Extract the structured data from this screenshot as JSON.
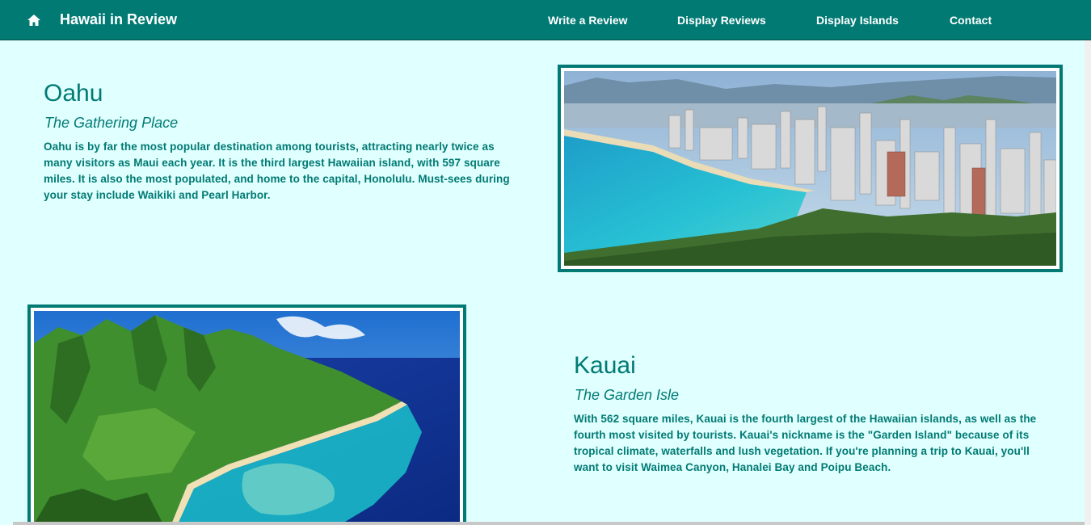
{
  "navbar": {
    "brand": "Hawaii in Review",
    "home_icon": "home-icon",
    "links": [
      "Write a Review",
      "Display Reviews",
      "Display Islands",
      "Contact"
    ]
  },
  "islands": [
    {
      "name": "Oahu",
      "nickname": "The Gathering Place",
      "description": "Oahu is by far the most popular destination among tourists, attracting nearly twice as many visitors as Maui each year. It is the third largest Hawaiian island, with 597 square miles. It is also the most populated, and home to the capital, Honolulu. Must-sees during your stay include Waikiki and Pearl Harbor."
    },
    {
      "name": "Kauai",
      "nickname": "The Garden Isle",
      "description": "With 562 square miles, Kauai is the fourth largest of the Hawaiian islands, as well as the fourth most visited by tourists. Kauai's nickname is the \"Garden Island\" because of its tropical climate, waterfalls and lush vegetation. If you're planning a trip to Kauai, you'll want to visit Waimea Canyon, Hanalei Bay and Poipu Beach."
    }
  ],
  "colors": {
    "brand": "#007a73",
    "background": "#e0ffff",
    "nav_text": "#ffffff"
  }
}
